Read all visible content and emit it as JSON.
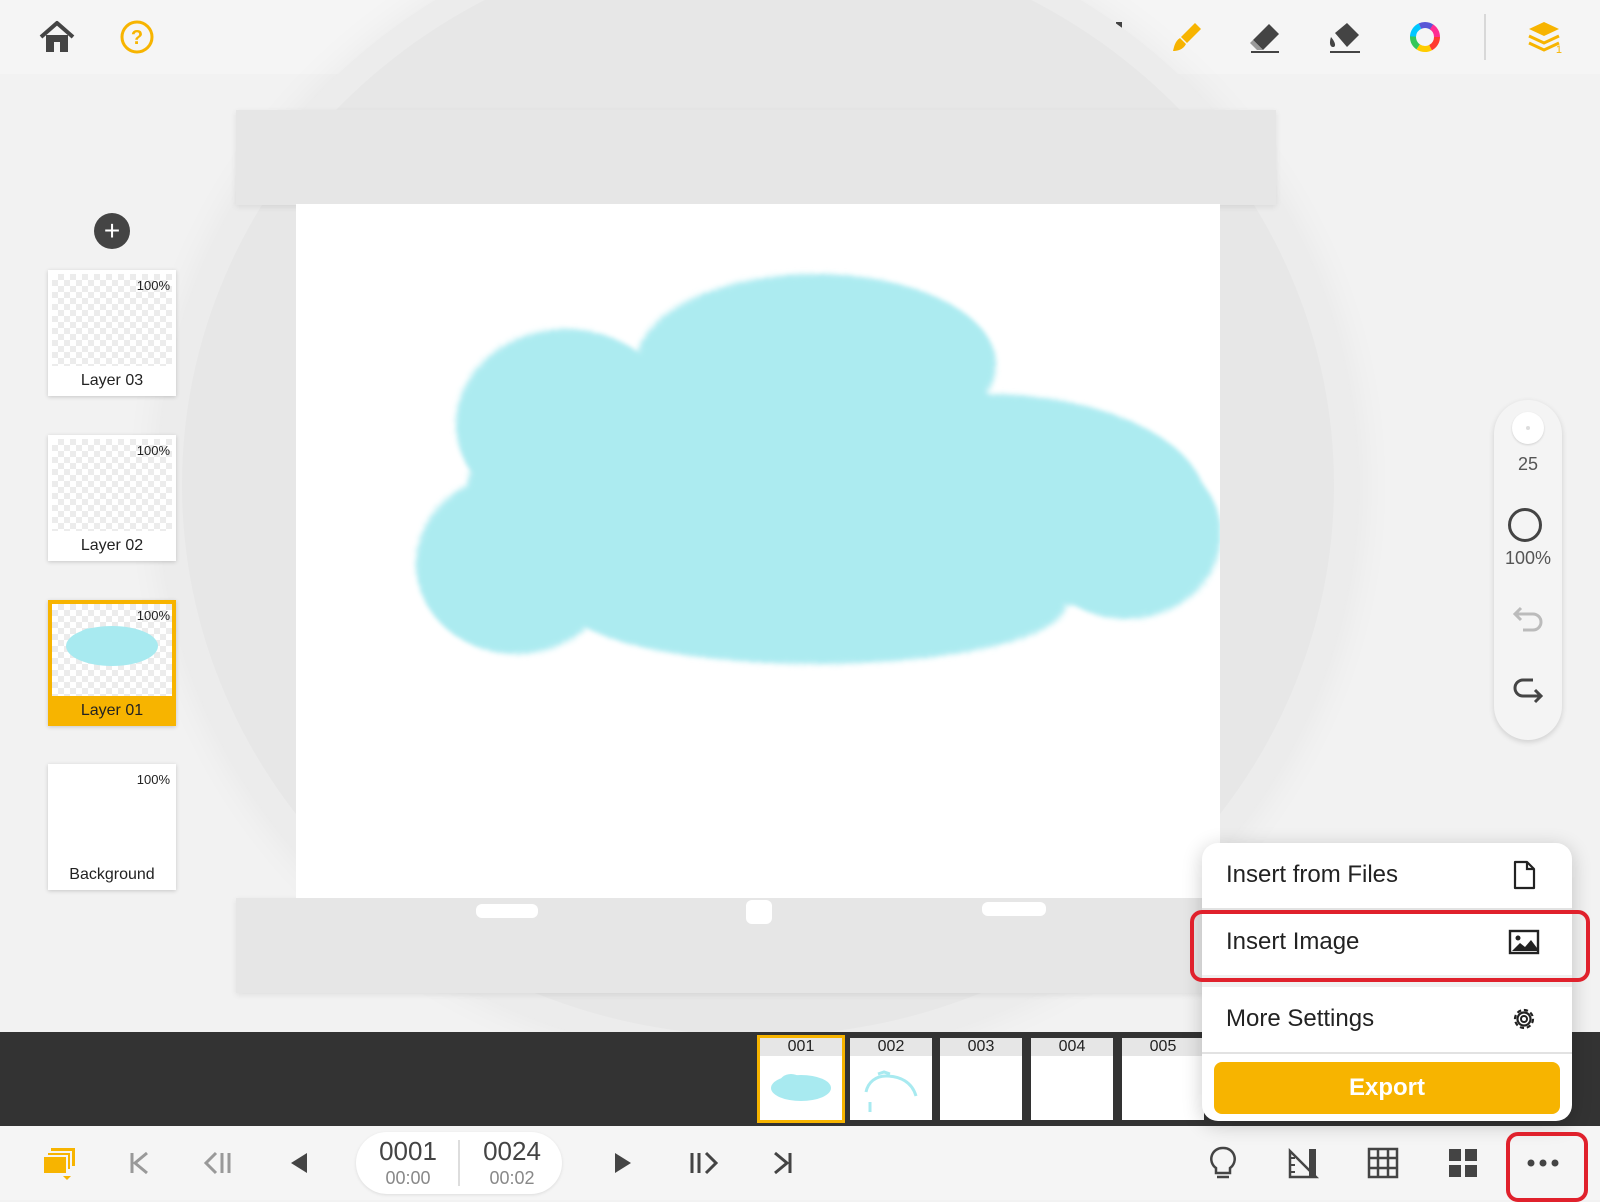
{
  "layers": [
    {
      "name": "Layer 03",
      "opacity": "100%",
      "active": false
    },
    {
      "name": "Layer 02",
      "opacity": "100%",
      "active": false
    },
    {
      "name": "Layer 01",
      "opacity": "100%",
      "active": true
    },
    {
      "name": "Background",
      "opacity": "100%",
      "active": false
    }
  ],
  "brush": {
    "size": "25",
    "opacity": "100%"
  },
  "frames": [
    {
      "label": "001",
      "active": true
    },
    {
      "label": "002",
      "active": false
    },
    {
      "label": "003",
      "active": false
    },
    {
      "label": "004",
      "active": false
    },
    {
      "label": "005",
      "active": false
    }
  ],
  "counter": {
    "current_frame": "0001",
    "current_time": "00:00",
    "total_frames": "0024",
    "total_time": "00:02"
  },
  "menu": {
    "items": [
      {
        "label": "Insert from Files",
        "icon": "file-icon"
      },
      {
        "label": "Insert Image",
        "icon": "image-icon"
      },
      {
        "label": "More Settings",
        "icon": "gear-icon"
      }
    ],
    "export_label": "Export"
  },
  "colors": {
    "accent": "#f7b400",
    "highlight": "#e0212c",
    "paint": "#a8eaf0",
    "filmstrip": "#333333"
  },
  "toolbar_icons": [
    "home-icon",
    "help-icon",
    "lasso-select-icon",
    "text-tool-icon",
    "brush-icon",
    "eraser-icon",
    "fill-bucket-icon",
    "color-wheel-icon",
    "layers-icon"
  ],
  "bottom_icons": [
    "frames-stack-icon",
    "first-frame-icon",
    "prev-frame-icon",
    "play-reverse-icon",
    "play-icon",
    "next-frame-icon",
    "last-frame-icon",
    "lightbulb-icon",
    "ruler-icon",
    "grid-icon",
    "panels-icon",
    "more-icon"
  ]
}
